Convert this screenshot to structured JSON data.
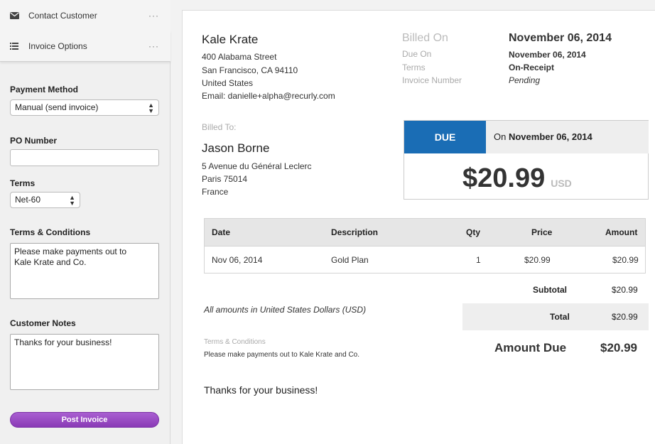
{
  "sidebar": {
    "actions": [
      {
        "label": "Contact Customer",
        "icon": "envelope-icon",
        "more": "···"
      },
      {
        "label": "Invoice Options",
        "icon": "list-icon",
        "more": "···"
      }
    ],
    "payment_method": {
      "label": "Payment Method",
      "value": "Manual (send invoice)"
    },
    "po_number": {
      "label": "PO Number",
      "value": ""
    },
    "terms": {
      "label": "Terms",
      "value": "Net-60"
    },
    "terms_conditions": {
      "label": "Terms & Conditions",
      "value": "Please make payments out to\nKale Krate and Co."
    },
    "customer_notes": {
      "label": "Customer Notes",
      "value": "Thanks for your business!"
    },
    "post_button": "Post Invoice"
  },
  "invoice": {
    "merchant": {
      "name": "Kale Krate",
      "street": "400 Alabama Street",
      "city": "San Francisco, CA 94110",
      "country": "United States",
      "email": "Email: danielle+alpha@recurly.com"
    },
    "meta_labels": {
      "billed_on": "Billed On",
      "due_on": "Due On",
      "terms": "Terms",
      "invoice_number": "Invoice Number"
    },
    "meta_values": {
      "billed_on": "November 06, 2014",
      "due_on": "November 06, 2014",
      "terms": "On-Receipt",
      "invoice_number": "Pending"
    },
    "billed_to": {
      "label": "Billed To:",
      "name": "Jason Borne",
      "street": "5 Avenue du Général Leclerc",
      "city": "Paris 75014",
      "country": "France"
    },
    "due": {
      "tag": "DUE",
      "on_prefix": "On",
      "on_date": "November 06, 2014",
      "amount": "$20.99",
      "currency": "USD"
    },
    "table": {
      "headers": {
        "date": "Date",
        "description": "Description",
        "qty": "Qty",
        "price": "Price",
        "amount": "Amount"
      },
      "rows": [
        {
          "date": "Nov 06, 2014",
          "description": "Gold Plan",
          "qty": "1",
          "price": "$20.99",
          "amount": "$20.99"
        }
      ]
    },
    "subtotal_label": "Subtotal",
    "subtotal_value": "$20.99",
    "total_label": "Total",
    "total_value": "$20.99",
    "amount_due_label": "Amount Due",
    "amount_due_value": "$20.99",
    "currency_note": "All amounts in United States Dollars (USD)",
    "terms_heading": "Terms & Conditions",
    "terms_text": "Please make payments out to Kale Krate and Co.",
    "notes": "Thanks for your business!"
  },
  "colors": {
    "due_blue": "#1a6db5",
    "post_purple": "#8a3ab6"
  }
}
